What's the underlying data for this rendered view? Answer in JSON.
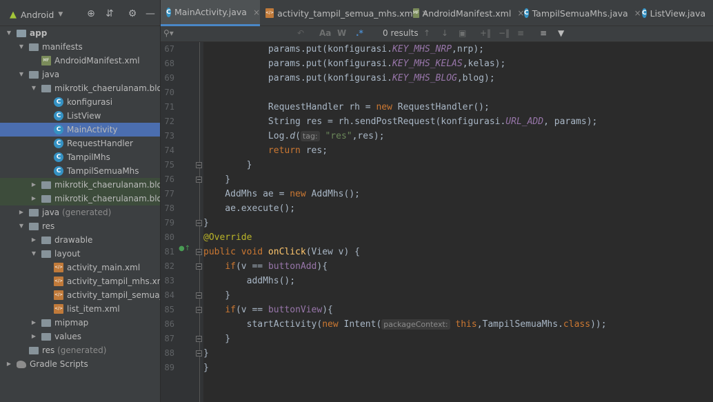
{
  "project": {
    "view_selector": "Android",
    "tree": [
      {
        "label": "app",
        "depth": 0,
        "icon": "module-folder-icon",
        "arrow": "down"
      },
      {
        "label": "manifests",
        "depth": 1,
        "icon": "folder-icon",
        "arrow": "down"
      },
      {
        "label": "AndroidManifest.xml",
        "depth": 2,
        "icon": "manifest-file-icon",
        "arrow": ""
      },
      {
        "label": "java",
        "depth": 1,
        "icon": "folder-icon",
        "arrow": "down"
      },
      {
        "label": "mikrotik_chaerulanam.blogs",
        "depth": 2,
        "icon": "package-icon",
        "arrow": "down"
      },
      {
        "label": "konfigurasi",
        "depth": 3,
        "icon": "class-icon",
        "arrow": ""
      },
      {
        "label": "ListView",
        "depth": 3,
        "icon": "class-icon",
        "arrow": ""
      },
      {
        "label": "MainActivity",
        "depth": 3,
        "icon": "class-icon",
        "arrow": "",
        "selected": true
      },
      {
        "label": "RequestHandler",
        "depth": 3,
        "icon": "class-icon",
        "arrow": ""
      },
      {
        "label": "TampilMhs",
        "depth": 3,
        "icon": "class-icon",
        "arrow": ""
      },
      {
        "label": "TampilSemuaMhs",
        "depth": 3,
        "icon": "class-icon",
        "arrow": ""
      },
      {
        "label": "mikrotik_chaerulanam.blogs",
        "depth": 2,
        "icon": "package-icon",
        "arrow": "right",
        "green": true
      },
      {
        "label": "mikrotik_chaerulanam.blogs",
        "depth": 2,
        "icon": "package-icon",
        "arrow": "right",
        "green": true
      },
      {
        "label": "java",
        "suffix": " (generated)",
        "depth": 1,
        "icon": "folder-icon",
        "arrow": "right"
      },
      {
        "label": "res",
        "depth": 1,
        "icon": "folder-icon",
        "arrow": "down"
      },
      {
        "label": "drawable",
        "depth": 2,
        "icon": "folder-icon",
        "arrow": "right"
      },
      {
        "label": "layout",
        "depth": 2,
        "icon": "folder-icon",
        "arrow": "down"
      },
      {
        "label": "activity_main.xml",
        "depth": 3,
        "icon": "xml-file-icon",
        "arrow": ""
      },
      {
        "label": "activity_tampil_mhs.xml",
        "depth": 3,
        "icon": "xml-file-icon",
        "arrow": ""
      },
      {
        "label": "activity_tampil_semua_m",
        "depth": 3,
        "icon": "xml-file-icon",
        "arrow": ""
      },
      {
        "label": "list_item.xml",
        "depth": 3,
        "icon": "xml-file-icon",
        "arrow": ""
      },
      {
        "label": "mipmap",
        "depth": 2,
        "icon": "folder-icon",
        "arrow": "right"
      },
      {
        "label": "values",
        "depth": 2,
        "icon": "folder-icon",
        "arrow": "right"
      },
      {
        "label": "res",
        "suffix": " (generated)",
        "depth": 1,
        "icon": "folder-icon",
        "arrow": ""
      },
      {
        "label": "Gradle Scripts",
        "depth": 0,
        "icon": "gradle-icon",
        "arrow": "right"
      }
    ]
  },
  "tabs": [
    {
      "label": "MainActivity.java",
      "icon": "class-icon",
      "active": true
    },
    {
      "label": "activity_tampil_semua_mhs.xml",
      "icon": "xml-file-icon"
    },
    {
      "label": "AndroidManifest.xml",
      "icon": "manifest-file-icon"
    },
    {
      "label": "TampilSemuaMhs.java",
      "icon": "class-icon"
    },
    {
      "label": "ListView.java",
      "icon": "class-icon"
    }
  ],
  "search": {
    "results": "0 results",
    "match_case": "Aa",
    "words": "W",
    "regex": ".*"
  },
  "editor": {
    "lines": [
      {
        "n": "67",
        "code": [
          [
            "            params.put(konfigurasi.",
            ""
          ],
          [
            "KEY_MHS_NRP",
            "fld"
          ],
          [
            ",nrp);",
            ""
          ]
        ]
      },
      {
        "n": "68",
        "code": [
          [
            "            params.put(konfigurasi.",
            ""
          ],
          [
            "KEY_MHS_KELAS",
            "fld"
          ],
          [
            ",kelas);",
            ""
          ]
        ]
      },
      {
        "n": "69",
        "code": [
          [
            "            params.put(konfigurasi.",
            ""
          ],
          [
            "KEY_MHS_BLOG",
            "fld"
          ],
          [
            ",blog);",
            ""
          ]
        ]
      },
      {
        "n": "70",
        "code": []
      },
      {
        "n": "71",
        "code": [
          [
            "            RequestHandler rh = ",
            ""
          ],
          [
            "new",
            "kw"
          ],
          [
            " RequestHandler();",
            ""
          ]
        ]
      },
      {
        "n": "72",
        "code": [
          [
            "            String res = rh.sendPostRequest(konfigurasi.",
            ""
          ],
          [
            "URL_ADD",
            "fld"
          ],
          [
            ", params);",
            ""
          ]
        ]
      },
      {
        "n": "73",
        "code": [
          [
            "            Log.",
            ""
          ],
          [
            "d",
            "it"
          ],
          [
            "(",
            ""
          ],
          [
            "tag:",
            "hint"
          ],
          [
            " ",
            ""
          ],
          [
            "\"res\"",
            "str"
          ],
          [
            ",res);",
            ""
          ]
        ]
      },
      {
        "n": "74",
        "code": [
          [
            "            ",
            ""
          ],
          [
            "return",
            "kw"
          ],
          [
            " res;",
            ""
          ]
        ]
      },
      {
        "n": "75",
        "code": [
          [
            "        }",
            ""
          ]
        ]
      },
      {
        "n": "76",
        "code": [
          [
            "    }",
            ""
          ]
        ]
      },
      {
        "n": "77",
        "code": [
          [
            "    AddMhs ae = ",
            ""
          ],
          [
            "new",
            "kw"
          ],
          [
            " AddMhs();",
            ""
          ]
        ]
      },
      {
        "n": "78",
        "code": [
          [
            "    ae.execute();",
            ""
          ]
        ]
      },
      {
        "n": "79",
        "code": [
          [
            "}",
            ""
          ]
        ]
      },
      {
        "n": "80",
        "code": [
          [
            "@Override",
            "ann"
          ]
        ]
      },
      {
        "n": "81",
        "code": [
          [
            "public void ",
            "kw"
          ],
          [
            "onClick",
            "mth"
          ],
          [
            "(View v) {",
            ""
          ]
        ]
      },
      {
        "n": "82",
        "code": [
          [
            "    ",
            ""
          ],
          [
            "if",
            "kw"
          ],
          [
            "(v == ",
            ""
          ],
          [
            "buttonAdd",
            "fldn"
          ],
          [
            "){",
            ""
          ]
        ]
      },
      {
        "n": "83",
        "code": [
          [
            "        addMhs();",
            ""
          ]
        ]
      },
      {
        "n": "84",
        "code": [
          [
            "    }",
            ""
          ]
        ]
      },
      {
        "n": "85",
        "code": [
          [
            "    ",
            ""
          ],
          [
            "if",
            "kw"
          ],
          [
            "(v == ",
            ""
          ],
          [
            "buttonView",
            "fldn"
          ],
          [
            "){",
            ""
          ]
        ]
      },
      {
        "n": "86",
        "code": [
          [
            "        startActivity(",
            ""
          ],
          [
            "new",
            "kw"
          ],
          [
            " Intent(",
            ""
          ],
          [
            "packageContext:",
            "hint"
          ],
          [
            " ",
            ""
          ],
          [
            "this",
            "kw"
          ],
          [
            ",TampilSemuaMhs.",
            ""
          ],
          [
            "class",
            "kw"
          ],
          [
            "));",
            ""
          ]
        ]
      },
      {
        "n": "87",
        "code": [
          [
            "    }",
            ""
          ]
        ]
      },
      {
        "n": "88",
        "code": [
          [
            "}",
            ""
          ]
        ]
      },
      {
        "n": "89",
        "code": [
          [
            "}",
            ""
          ]
        ]
      }
    ]
  }
}
